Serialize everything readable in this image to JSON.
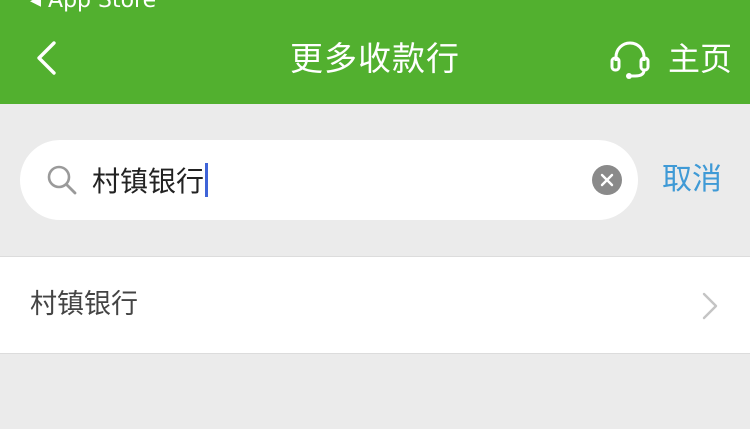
{
  "status_bar": {
    "back_to_app": "◂ App Store"
  },
  "nav": {
    "title": "更多收款行",
    "back_icon": "chevron-left-icon",
    "home_icon": "headset-icon",
    "home_label": "主页"
  },
  "search": {
    "value": "村镇银行",
    "search_icon": "search-icon",
    "clear_icon": "clear-icon",
    "cancel_label": "取消"
  },
  "results": [
    {
      "label": "村镇银行"
    }
  ],
  "colors": {
    "brand_green": "#52b02f",
    "cancel_blue": "#3f9ad6",
    "caret_blue": "#3f64d8",
    "background": "#ebebeb"
  }
}
